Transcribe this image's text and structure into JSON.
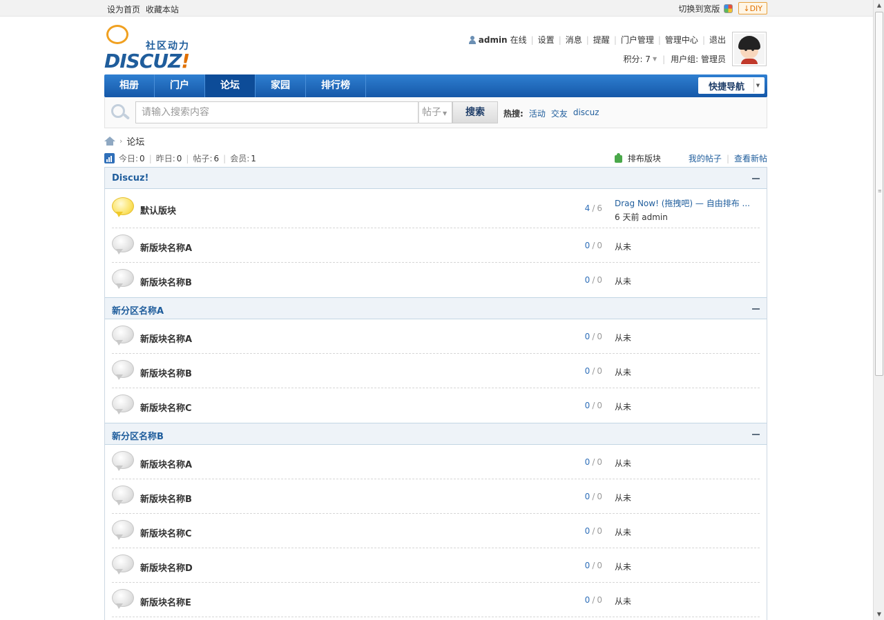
{
  "topbar": {
    "set_home": "设为首页",
    "bookmark": "收藏本站",
    "switch_width": "切换到宽版",
    "diy": "DIY",
    "diy_arrow": "↓"
  },
  "header": {
    "logo": {
      "slogan": "社区动力",
      "word_main": "DISCUZ",
      "word_mark": "!"
    },
    "user": {
      "name": "admin",
      "status": "在线",
      "links": [
        "设置",
        "消息",
        "提醒",
        "门户管理",
        "管理中心",
        "退出"
      ]
    },
    "score_label": "积分: 7",
    "usergroup_label": "用户组: 管理员"
  },
  "nav": {
    "items": [
      "相册",
      "门户",
      "论坛",
      "家园",
      "排行榜"
    ],
    "active_index": 2,
    "quick_nav": "快捷导航"
  },
  "search": {
    "placeholder": "请输入搜索内容",
    "type": "帖子",
    "button": "搜索",
    "hot_label": "热搜:",
    "hot_links": [
      "活动",
      "交友",
      "discuz"
    ]
  },
  "breadcrumb": {
    "current": "论坛"
  },
  "stats": {
    "today_label": "今日:",
    "today": "0",
    "yesterday_label": "昨日:",
    "yesterday": "0",
    "posts_label": "帖子:",
    "posts": "6",
    "members_label": "会员:",
    "members": "1"
  },
  "links": {
    "order_forums": "排布版块",
    "my_posts": "我的帖子",
    "new_posts": "查看新帖"
  },
  "groups": [
    {
      "title": "Discuz!",
      "forums": [
        {
          "name": "默认版块",
          "threads": "4",
          "posts": "6",
          "last_title": "Drag Now! (拖拽吧) — 自由排布 ...",
          "last_meta": "6 天前 admin",
          "new": true
        },
        {
          "name": "新版块名称A",
          "threads": "0",
          "posts": "0",
          "last": "从未"
        },
        {
          "name": "新版块名称B",
          "threads": "0",
          "posts": "0",
          "last": "从未"
        }
      ]
    },
    {
      "title": "新分区名称A",
      "forums": [
        {
          "name": "新版块名称A",
          "threads": "0",
          "posts": "0",
          "last": "从未"
        },
        {
          "name": "新版块名称B",
          "threads": "0",
          "posts": "0",
          "last": "从未"
        },
        {
          "name": "新版块名称C",
          "threads": "0",
          "posts": "0",
          "last": "从未"
        }
      ]
    },
    {
      "title": "新分区名称B",
      "forums": [
        {
          "name": "新版块名称A",
          "threads": "0",
          "posts": "0",
          "last": "从未"
        },
        {
          "name": "新版块名称B",
          "threads": "0",
          "posts": "0",
          "last": "从未"
        },
        {
          "name": "新版块名称C",
          "threads": "0",
          "posts": "0",
          "last": "从未"
        },
        {
          "name": "新版块名称D",
          "threads": "0",
          "posts": "0",
          "last": "从未"
        },
        {
          "name": "新版块名称E",
          "threads": "0",
          "posts": "0",
          "last": "从未"
        }
      ]
    }
  ]
}
